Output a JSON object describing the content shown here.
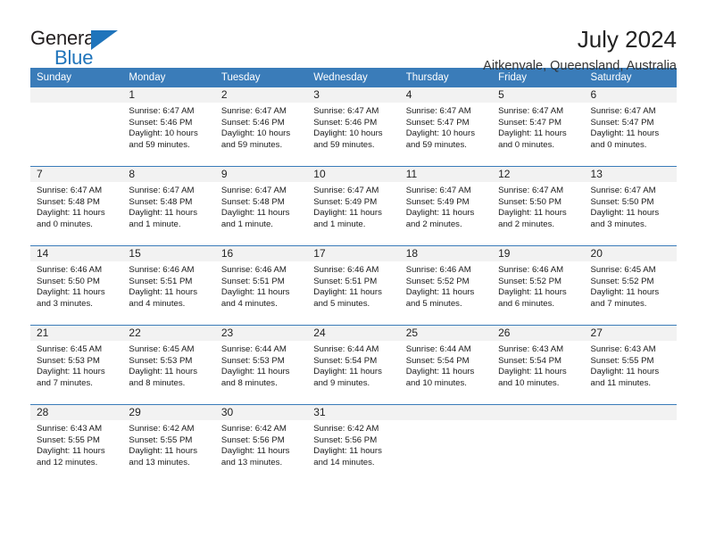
{
  "brand": {
    "name_top": "General",
    "name_bottom": "Blue",
    "accent_color": "#1f74bb"
  },
  "header": {
    "title": "July 2024",
    "subtitle": "Aitkenvale, Queensland, Australia"
  },
  "theme": {
    "header_row_bg": "#3a7cb9",
    "header_row_text": "#ffffff",
    "daynum_band_bg": "#f2f2f2",
    "row_divider": "#3a7cb9"
  },
  "weekday_headers": [
    "Sunday",
    "Monday",
    "Tuesday",
    "Wednesday",
    "Thursday",
    "Friday",
    "Saturday"
  ],
  "weeks": [
    [
      {
        "day": "",
        "sunrise": "",
        "sunset": "",
        "daylight_1": "",
        "daylight_2": ""
      },
      {
        "day": "1",
        "sunrise": "Sunrise: 6:47 AM",
        "sunset": "Sunset: 5:46 PM",
        "daylight_1": "Daylight: 10 hours",
        "daylight_2": "and 59 minutes."
      },
      {
        "day": "2",
        "sunrise": "Sunrise: 6:47 AM",
        "sunset": "Sunset: 5:46 PM",
        "daylight_1": "Daylight: 10 hours",
        "daylight_2": "and 59 minutes."
      },
      {
        "day": "3",
        "sunrise": "Sunrise: 6:47 AM",
        "sunset": "Sunset: 5:46 PM",
        "daylight_1": "Daylight: 10 hours",
        "daylight_2": "and 59 minutes."
      },
      {
        "day": "4",
        "sunrise": "Sunrise: 6:47 AM",
        "sunset": "Sunset: 5:47 PM",
        "daylight_1": "Daylight: 10 hours",
        "daylight_2": "and 59 minutes."
      },
      {
        "day": "5",
        "sunrise": "Sunrise: 6:47 AM",
        "sunset": "Sunset: 5:47 PM",
        "daylight_1": "Daylight: 11 hours",
        "daylight_2": "and 0 minutes."
      },
      {
        "day": "6",
        "sunrise": "Sunrise: 6:47 AM",
        "sunset": "Sunset: 5:47 PM",
        "daylight_1": "Daylight: 11 hours",
        "daylight_2": "and 0 minutes."
      }
    ],
    [
      {
        "day": "7",
        "sunrise": "Sunrise: 6:47 AM",
        "sunset": "Sunset: 5:48 PM",
        "daylight_1": "Daylight: 11 hours",
        "daylight_2": "and 0 minutes."
      },
      {
        "day": "8",
        "sunrise": "Sunrise: 6:47 AM",
        "sunset": "Sunset: 5:48 PM",
        "daylight_1": "Daylight: 11 hours",
        "daylight_2": "and 1 minute."
      },
      {
        "day": "9",
        "sunrise": "Sunrise: 6:47 AM",
        "sunset": "Sunset: 5:48 PM",
        "daylight_1": "Daylight: 11 hours",
        "daylight_2": "and 1 minute."
      },
      {
        "day": "10",
        "sunrise": "Sunrise: 6:47 AM",
        "sunset": "Sunset: 5:49 PM",
        "daylight_1": "Daylight: 11 hours",
        "daylight_2": "and 1 minute."
      },
      {
        "day": "11",
        "sunrise": "Sunrise: 6:47 AM",
        "sunset": "Sunset: 5:49 PM",
        "daylight_1": "Daylight: 11 hours",
        "daylight_2": "and 2 minutes."
      },
      {
        "day": "12",
        "sunrise": "Sunrise: 6:47 AM",
        "sunset": "Sunset: 5:50 PM",
        "daylight_1": "Daylight: 11 hours",
        "daylight_2": "and 2 minutes."
      },
      {
        "day": "13",
        "sunrise": "Sunrise: 6:47 AM",
        "sunset": "Sunset: 5:50 PM",
        "daylight_1": "Daylight: 11 hours",
        "daylight_2": "and 3 minutes."
      }
    ],
    [
      {
        "day": "14",
        "sunrise": "Sunrise: 6:46 AM",
        "sunset": "Sunset: 5:50 PM",
        "daylight_1": "Daylight: 11 hours",
        "daylight_2": "and 3 minutes."
      },
      {
        "day": "15",
        "sunrise": "Sunrise: 6:46 AM",
        "sunset": "Sunset: 5:51 PM",
        "daylight_1": "Daylight: 11 hours",
        "daylight_2": "and 4 minutes."
      },
      {
        "day": "16",
        "sunrise": "Sunrise: 6:46 AM",
        "sunset": "Sunset: 5:51 PM",
        "daylight_1": "Daylight: 11 hours",
        "daylight_2": "and 4 minutes."
      },
      {
        "day": "17",
        "sunrise": "Sunrise: 6:46 AM",
        "sunset": "Sunset: 5:51 PM",
        "daylight_1": "Daylight: 11 hours",
        "daylight_2": "and 5 minutes."
      },
      {
        "day": "18",
        "sunrise": "Sunrise: 6:46 AM",
        "sunset": "Sunset: 5:52 PM",
        "daylight_1": "Daylight: 11 hours",
        "daylight_2": "and 5 minutes."
      },
      {
        "day": "19",
        "sunrise": "Sunrise: 6:46 AM",
        "sunset": "Sunset: 5:52 PM",
        "daylight_1": "Daylight: 11 hours",
        "daylight_2": "and 6 minutes."
      },
      {
        "day": "20",
        "sunrise": "Sunrise: 6:45 AM",
        "sunset": "Sunset: 5:52 PM",
        "daylight_1": "Daylight: 11 hours",
        "daylight_2": "and 7 minutes."
      }
    ],
    [
      {
        "day": "21",
        "sunrise": "Sunrise: 6:45 AM",
        "sunset": "Sunset: 5:53 PM",
        "daylight_1": "Daylight: 11 hours",
        "daylight_2": "and 7 minutes."
      },
      {
        "day": "22",
        "sunrise": "Sunrise: 6:45 AM",
        "sunset": "Sunset: 5:53 PM",
        "daylight_1": "Daylight: 11 hours",
        "daylight_2": "and 8 minutes."
      },
      {
        "day": "23",
        "sunrise": "Sunrise: 6:44 AM",
        "sunset": "Sunset: 5:53 PM",
        "daylight_1": "Daylight: 11 hours",
        "daylight_2": "and 8 minutes."
      },
      {
        "day": "24",
        "sunrise": "Sunrise: 6:44 AM",
        "sunset": "Sunset: 5:54 PM",
        "daylight_1": "Daylight: 11 hours",
        "daylight_2": "and 9 minutes."
      },
      {
        "day": "25",
        "sunrise": "Sunrise: 6:44 AM",
        "sunset": "Sunset: 5:54 PM",
        "daylight_1": "Daylight: 11 hours",
        "daylight_2": "and 10 minutes."
      },
      {
        "day": "26",
        "sunrise": "Sunrise: 6:43 AM",
        "sunset": "Sunset: 5:54 PM",
        "daylight_1": "Daylight: 11 hours",
        "daylight_2": "and 10 minutes."
      },
      {
        "day": "27",
        "sunrise": "Sunrise: 6:43 AM",
        "sunset": "Sunset: 5:55 PM",
        "daylight_1": "Daylight: 11 hours",
        "daylight_2": "and 11 minutes."
      }
    ],
    [
      {
        "day": "28",
        "sunrise": "Sunrise: 6:43 AM",
        "sunset": "Sunset: 5:55 PM",
        "daylight_1": "Daylight: 11 hours",
        "daylight_2": "and 12 minutes."
      },
      {
        "day": "29",
        "sunrise": "Sunrise: 6:42 AM",
        "sunset": "Sunset: 5:55 PM",
        "daylight_1": "Daylight: 11 hours",
        "daylight_2": "and 13 minutes."
      },
      {
        "day": "30",
        "sunrise": "Sunrise: 6:42 AM",
        "sunset": "Sunset: 5:56 PM",
        "daylight_1": "Daylight: 11 hours",
        "daylight_2": "and 13 minutes."
      },
      {
        "day": "31",
        "sunrise": "Sunrise: 6:42 AM",
        "sunset": "Sunset: 5:56 PM",
        "daylight_1": "Daylight: 11 hours",
        "daylight_2": "and 14 minutes."
      },
      {
        "day": "",
        "sunrise": "",
        "sunset": "",
        "daylight_1": "",
        "daylight_2": ""
      },
      {
        "day": "",
        "sunrise": "",
        "sunset": "",
        "daylight_1": "",
        "daylight_2": ""
      },
      {
        "day": "",
        "sunrise": "",
        "sunset": "",
        "daylight_1": "",
        "daylight_2": ""
      }
    ]
  ]
}
